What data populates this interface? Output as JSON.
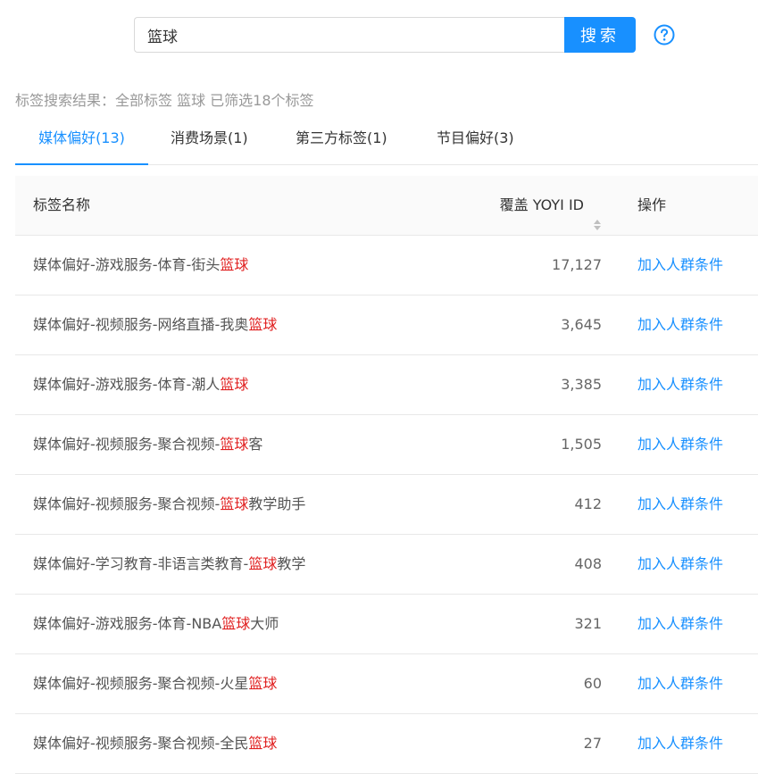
{
  "search": {
    "value": "篮球",
    "button_label": "搜索"
  },
  "help_icon": "question-circle-icon",
  "result_summary": "标签搜索结果：全部标签 篮球 已筛选18个标签",
  "tabs": [
    {
      "label": "媒体偏好(13)",
      "active": true
    },
    {
      "label": "消费场景(1)",
      "active": false
    },
    {
      "label": "第三方标签(1)",
      "active": false
    },
    {
      "label": "节目偏好(3)",
      "active": false
    }
  ],
  "table": {
    "headers": {
      "name": "标签名称",
      "cover": "覆盖 YOYI ID",
      "op": "操作"
    },
    "highlight_word": "篮球",
    "rows": [
      {
        "prefix": "媒体偏好-游戏服务-体育-街头",
        "match": "篮球",
        "suffix": "",
        "cover": "17,127",
        "op": "加入人群条件"
      },
      {
        "prefix": "媒体偏好-视频服务-网络直播-我奥",
        "match": "篮球",
        "suffix": "",
        "cover": "3,645",
        "op": "加入人群条件"
      },
      {
        "prefix": "媒体偏好-游戏服务-体育-潮人",
        "match": "篮球",
        "suffix": "",
        "cover": "3,385",
        "op": "加入人群条件"
      },
      {
        "prefix": "媒体偏好-视频服务-聚合视频-",
        "match": "篮球",
        "suffix": "客",
        "cover": "1,505",
        "op": "加入人群条件"
      },
      {
        "prefix": "媒体偏好-视频服务-聚合视频-",
        "match": "篮球",
        "suffix": "教学助手",
        "cover": "412",
        "op": "加入人群条件"
      },
      {
        "prefix": "媒体偏好-学习教育-非语言类教育-",
        "match": "篮球",
        "suffix": "教学",
        "cover": "408",
        "op": "加入人群条件"
      },
      {
        "prefix": "媒体偏好-游戏服务-体育-NBA",
        "match": "篮球",
        "suffix": "大师",
        "cover": "321",
        "op": "加入人群条件"
      },
      {
        "prefix": "媒体偏好-视频服务-聚合视频-火星",
        "match": "篮球",
        "suffix": "",
        "cover": "60",
        "op": "加入人群条件"
      },
      {
        "prefix": "媒体偏好-视频服务-聚合视频-全民",
        "match": "篮球",
        "suffix": "",
        "cover": "27",
        "op": "加入人群条件"
      }
    ]
  },
  "colors": {
    "accent": "#1890ff",
    "highlight": "#e02020"
  }
}
